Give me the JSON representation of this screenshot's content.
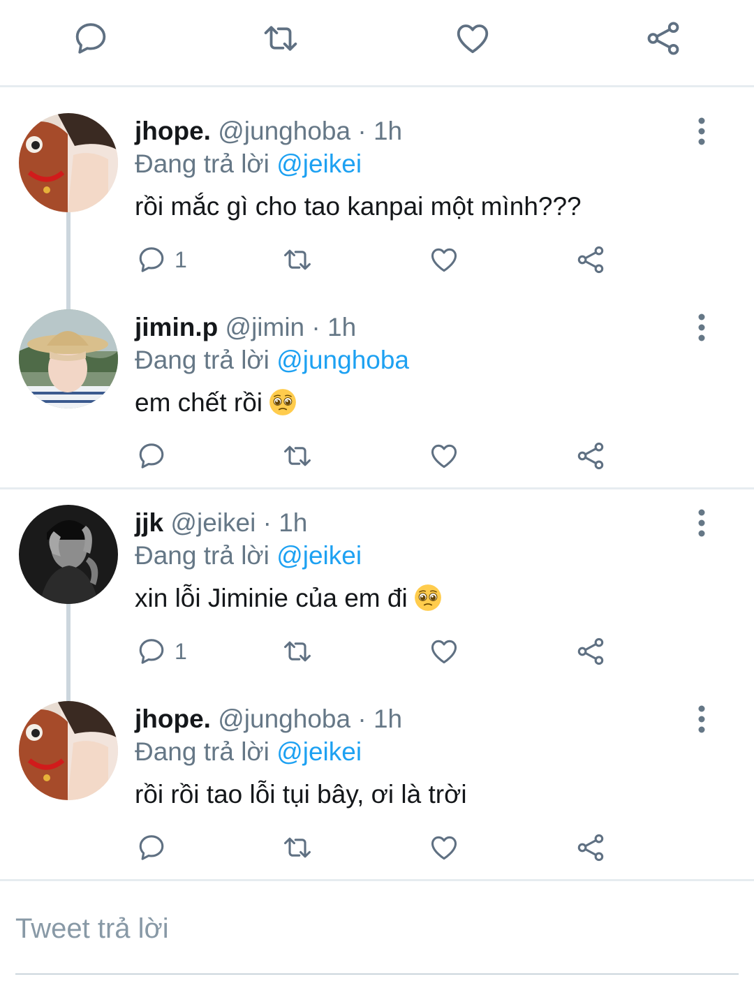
{
  "top_actions": {
    "reply_icon": "reply-icon",
    "retweet_icon": "retweet-icon",
    "like_icon": "like-icon",
    "share_icon": "share-icon"
  },
  "tweets": [
    {
      "name": "jhope.",
      "handle": "@junghoba",
      "separator": "·",
      "time": "1h",
      "replying_prefix": "Đang trả lời",
      "replying_to": "@jeikei",
      "text": "rồi mắc gì cho tao kanpai một mình???",
      "reply_count": "1"
    },
    {
      "name": "jimin.p",
      "handle": "@jimin",
      "separator": "·",
      "time": "1h",
      "replying_prefix": "Đang trả lời",
      "replying_to": "@junghoba",
      "text": "em chết rồi",
      "emoji": "pleading-face",
      "reply_count": ""
    },
    {
      "name": "jjk",
      "handle": "@jeikei",
      "separator": "·",
      "time": "1h",
      "replying_prefix": "Đang trả lời",
      "replying_to": "@jeikei",
      "text": "xin lỗi Jiminie của em đi",
      "emoji": "pleading-face",
      "reply_count": "1"
    },
    {
      "name": "jhope.",
      "handle": "@junghoba",
      "separator": "·",
      "time": "1h",
      "replying_prefix": "Đang trả lời",
      "replying_to": "@jeikei",
      "text": "rồi rồi tao lỗi tụi bây, ơi là trời",
      "reply_count": ""
    }
  ],
  "compose": {
    "placeholder": "Tweet trả lời",
    "value": ""
  },
  "colors": {
    "accent": "#1da1f2",
    "secondary_text": "#657786",
    "icon": "#5f7082",
    "divider": "#e6ecf0",
    "thread_line": "#ccd6dd"
  }
}
